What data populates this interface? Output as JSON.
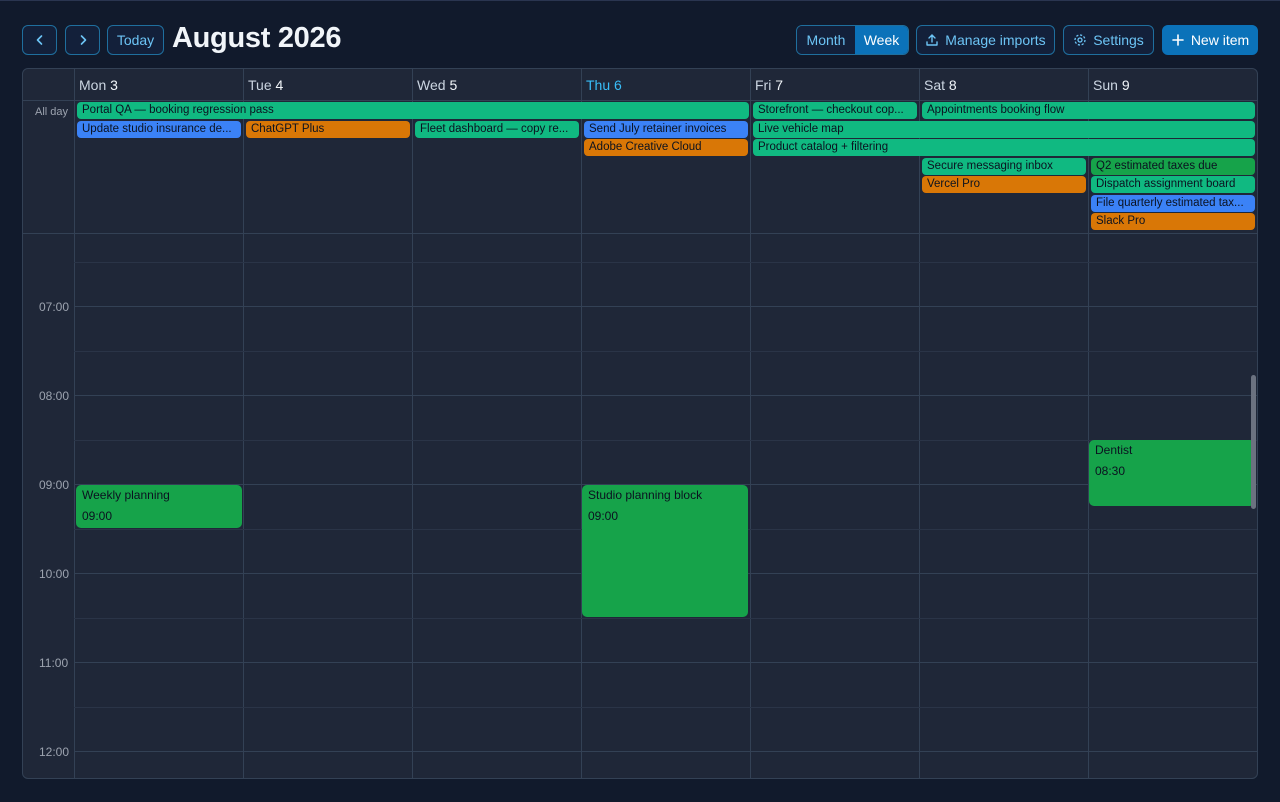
{
  "toolbar": {
    "prev_icon": "chevron-left-icon",
    "next_icon": "chevron-right-icon",
    "today_label": "Today",
    "title": "August 2026",
    "view_month_label": "Month",
    "view_week_label": "Week",
    "active_view": "Week",
    "manage_imports_label": "Manage imports",
    "settings_label": "Settings",
    "new_item_label": "New item"
  },
  "days": [
    {
      "name": "Mon",
      "num": "3",
      "today": false
    },
    {
      "name": "Tue",
      "num": "4",
      "today": false
    },
    {
      "name": "Wed",
      "num": "5",
      "today": false
    },
    {
      "name": "Thu",
      "num": "6",
      "today": true
    },
    {
      "name": "Fri",
      "num": "7",
      "today": false
    },
    {
      "name": "Sat",
      "num": "8",
      "today": false
    },
    {
      "name": "Sun",
      "num": "9",
      "today": false
    }
  ],
  "allday_label": "All day",
  "allday_events": [
    {
      "title": "Portal QA — booking regression pass",
      "start_day": "Mon",
      "end_day": "Thu",
      "color": "teal"
    },
    {
      "title": "Update studio insurance de...",
      "start_day": "Mon",
      "end_day": "Mon",
      "color": "blue"
    },
    {
      "title": "ChatGPT Plus",
      "start_day": "Tue",
      "end_day": "Tue",
      "color": "orange"
    },
    {
      "title": "Fleet dashboard — copy re...",
      "start_day": "Wed",
      "end_day": "Wed",
      "color": "teal"
    },
    {
      "title": "Send July retainer invoices",
      "start_day": "Thu",
      "end_day": "Thu",
      "color": "blue"
    },
    {
      "title": "Adobe Creative Cloud",
      "start_day": "Thu",
      "end_day": "Thu",
      "color": "orange"
    },
    {
      "title": "Storefront — checkout cop...",
      "start_day": "Fri",
      "end_day": "Fri",
      "color": "teal"
    },
    {
      "title": "Live vehicle map",
      "start_day": "Fri",
      "end_day": "Sun",
      "color": "teal"
    },
    {
      "title": "Product catalog + filtering",
      "start_day": "Fri",
      "end_day": "Sun",
      "color": "teal"
    },
    {
      "title": "Appointments booking flow",
      "start_day": "Sat",
      "end_day": "Sun",
      "color": "teal"
    },
    {
      "title": "Secure messaging inbox",
      "start_day": "Sat",
      "end_day": "Sat",
      "color": "teal"
    },
    {
      "title": "Vercel Pro",
      "start_day": "Sat",
      "end_day": "Sat",
      "color": "orange"
    },
    {
      "title": "Q2 estimated taxes due",
      "start_day": "Sun",
      "end_day": "Sun",
      "color": "green"
    },
    {
      "title": "Dispatch assignment board",
      "start_day": "Sun",
      "end_day": "Sun",
      "color": "teal"
    },
    {
      "title": "File quarterly estimated tax...",
      "start_day": "Sun",
      "end_day": "Sun",
      "color": "blue"
    },
    {
      "title": "Slack Pro",
      "start_day": "Sun",
      "end_day": "Sun",
      "color": "orange"
    }
  ],
  "time_labels": [
    "07:00",
    "08:00",
    "09:00",
    "10:00",
    "11:00",
    "12:00"
  ],
  "timed_events": [
    {
      "title": "Weekly planning",
      "time": "09:00",
      "day": "Mon"
    },
    {
      "title": "Studio planning block",
      "time": "09:00",
      "day": "Thu"
    },
    {
      "title": "Dentist",
      "time": "08:30",
      "day": "Sun"
    }
  ],
  "colors": {
    "accent": "#0b72b9",
    "today": "#38bdf8",
    "teal": "#10b981",
    "blue": "#3b82f6",
    "orange": "#d97706",
    "green": "#16a34a"
  }
}
